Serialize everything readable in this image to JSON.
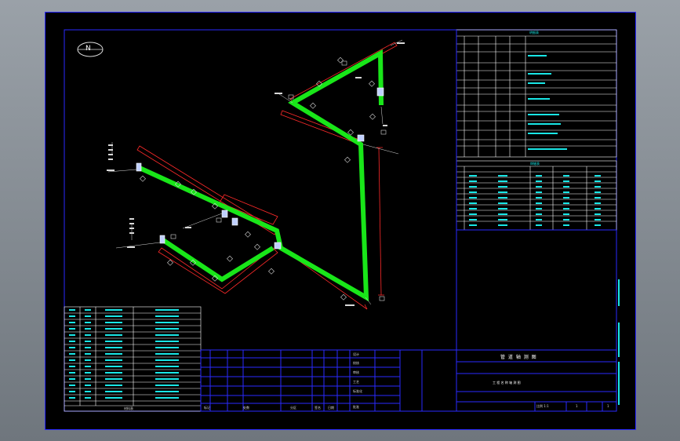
{
  "viewer": {
    "background": "#7e858c"
  },
  "drawing": {
    "north_label": "N",
    "colors": {
      "pipe": "#19e619",
      "frame": "#2a2aff",
      "table_text": "#19e6e6",
      "annotation": "#ff2a2a"
    },
    "main_title": "管 道 轴 测 图",
    "subtitle": "工 程 名 称 轴 测 图",
    "scale_note": "比例 1:1",
    "page": "1",
    "pages": "1",
    "sign_rows": [
      "设计",
      "校核",
      "审核",
      "工艺",
      "标准化",
      "批准"
    ],
    "bottom_labels": [
      "标记",
      "处数",
      "分区",
      "签名",
      "日期"
    ],
    "table1_title": "材料表",
    "table2_title": "焊缝表",
    "table3_title": "明细表"
  }
}
